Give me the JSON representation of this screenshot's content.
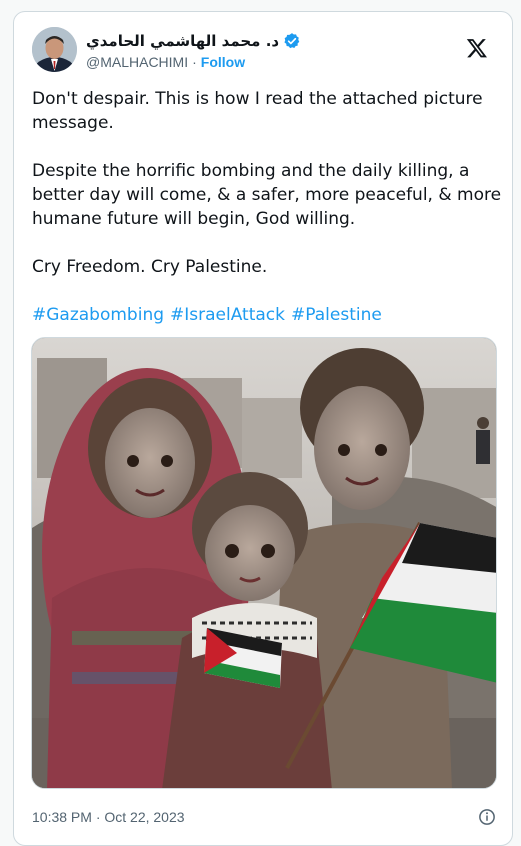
{
  "author": {
    "name": "د. محمد الهاشمي الحامدي",
    "handle": "@MALHACHIMI",
    "separator": "·",
    "follow_label": "Follow",
    "verified": true
  },
  "tweet": {
    "paragraphs": [
      "Don't despair. This is how I read the attached picture message.",
      "Despite the horrific bombing and the daily killing, a better day will come, & a safer, more peaceful, & more humane future will begin, God willing.",
      "Cry Freedom. Cry Palestine."
    ],
    "hashtags": [
      "#Gazabombing",
      "#IsraelAttack",
      "#Palestine"
    ]
  },
  "footer": {
    "timestamp": "10:38 PM · Oct 22, 2023"
  },
  "icons": {
    "platform": "x-logo-icon",
    "verified": "verified-badge-icon",
    "info": "info-icon"
  },
  "colors": {
    "accent": "#1d9bf0",
    "text": "#0f1419",
    "muted": "#536471",
    "border": "#cfd9de"
  }
}
